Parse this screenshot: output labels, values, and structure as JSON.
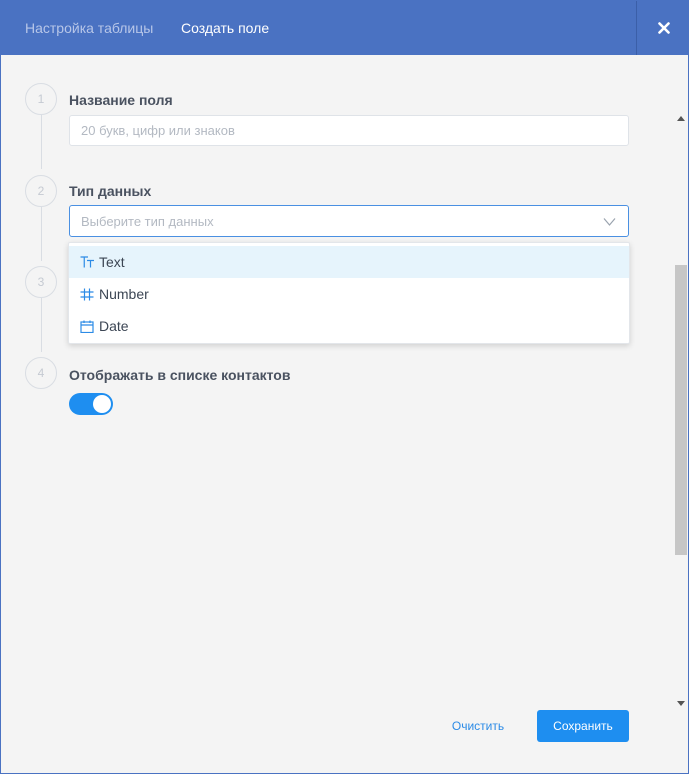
{
  "header": {
    "tabs": [
      {
        "label": "Настройка таблицы",
        "active": false
      },
      {
        "label": "Создать поле",
        "active": true
      }
    ],
    "close_icon": "close-icon"
  },
  "steps": [
    {
      "number": "1",
      "label": "Название поля"
    },
    {
      "number": "2",
      "label": "Тип данных"
    },
    {
      "number": "3",
      "label": ""
    },
    {
      "number": "4",
      "label": "Отображать в списке контактов"
    }
  ],
  "field_name": {
    "value": "",
    "placeholder": "20 букв, цифр или знаков"
  },
  "data_type": {
    "placeholder": "Выберите тип данных",
    "options": [
      {
        "label": "Text",
        "icon": "text-type-icon",
        "highlighted": true
      },
      {
        "label": "Number",
        "icon": "hash-icon",
        "highlighted": false
      },
      {
        "label": "Date",
        "icon": "calendar-icon",
        "highlighted": false
      }
    ]
  },
  "show_in_contacts": {
    "enabled": true
  },
  "buttons": {
    "clear": "Очистить",
    "save": "Сохранить"
  },
  "colors": {
    "header_bg": "#4a72c2",
    "accent": "#1e8ef0",
    "highlight": "#e6f4fc"
  }
}
